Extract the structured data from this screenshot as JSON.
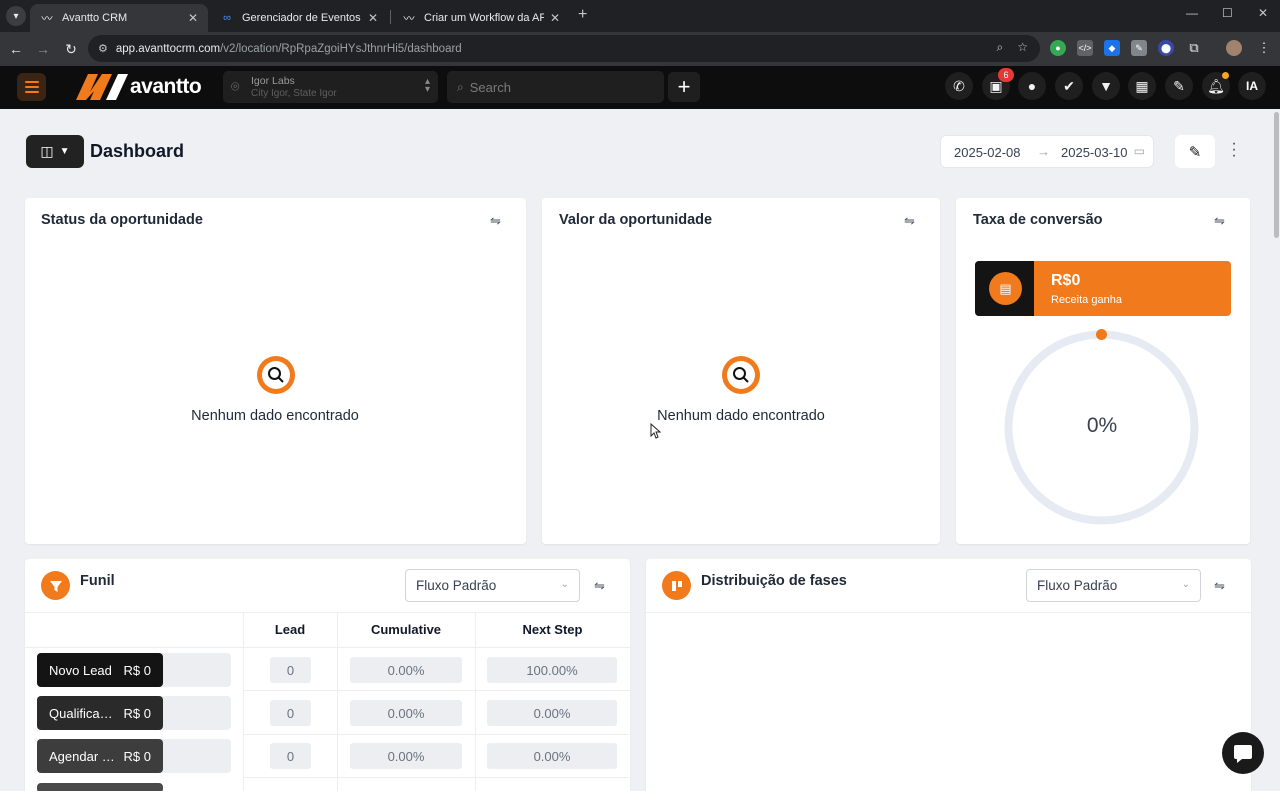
{
  "browser": {
    "tabs": [
      {
        "title": "Avantto CRM",
        "active": true
      },
      {
        "title": "Gerenciador de Eventos",
        "active": false
      },
      {
        "title": "Criar um Workflow da API de C",
        "active": false
      }
    ],
    "url_host": "app.avanttocrm.com",
    "url_path": "/v2/location/RpRpaZgoiHYsJthnrHi5/dashboard"
  },
  "header": {
    "logo_text": "avantto",
    "location_name": "Igor Labs",
    "location_sub": "City Igor, State Igor",
    "search_placeholder": "Search",
    "notification_badge": "6",
    "avatar_initials": "IA"
  },
  "dashboard": {
    "title": "Dashboard",
    "date_start": "2025-02-08",
    "date_end": "2025-03-10"
  },
  "cards": {
    "status": {
      "title": "Status da oportunidade",
      "empty_text": "Nenhum dado encontrado"
    },
    "valor": {
      "title": "Valor da oportunidade",
      "empty_text": "Nenhum dado encontrado"
    },
    "taxa": {
      "title": "Taxa de conversão",
      "revenue_value": "R$0",
      "revenue_label": "Receita ganha",
      "conversion_value": "0%",
      "conversion_fraction": 0
    }
  },
  "funil": {
    "title": "Funil",
    "pipeline_select": "Fluxo Padrão",
    "columns": [
      "Lead",
      "Cumulative",
      "Next Step"
    ],
    "rows": [
      {
        "stage": "Novo Lead",
        "value": "R$ 0",
        "lead": "0",
        "cumulative": "0.00%",
        "next_step": "100.00%"
      },
      {
        "stage": "Qualificação",
        "value": "R$ 0",
        "lead": "0",
        "cumulative": "0.00%",
        "next_step": "0.00%"
      },
      {
        "stage": "Agendar reunião",
        "value": "R$ 0",
        "lead": "0",
        "cumulative": "0.00%",
        "next_step": "0.00%"
      }
    ]
  },
  "distribuicao": {
    "title": "Distribuição de fases",
    "pipeline_select": "Fluxo Padrão"
  },
  "colors": {
    "accent": "#f07a1c",
    "header_bg": "#0d0d0d",
    "page_bg": "#eef0f3"
  }
}
